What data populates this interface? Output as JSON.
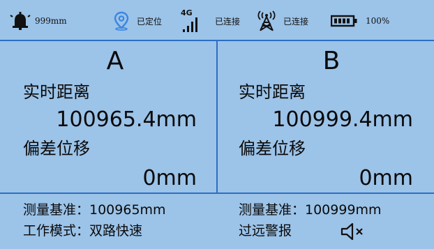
{
  "status": {
    "alarm_value": "999mm",
    "location_text": "已定位",
    "network_type": "4G",
    "network_text": "已连接",
    "signal_text": "已连接",
    "battery_text": "100%"
  },
  "channels": [
    {
      "name": "A",
      "distance_label": "实时距离",
      "distance_value": "100965.4mm",
      "offset_label": "偏差位移",
      "offset_value": "0mm"
    },
    {
      "name": "B",
      "distance_label": "实时距离",
      "distance_value": "100999.4mm",
      "offset_label": "偏差位移",
      "offset_value": "0mm"
    }
  ],
  "footer": {
    "baseline_a": "测量基准：100965mm",
    "baseline_b": "测量基准：100999mm",
    "mode": "工作模式：双路快速",
    "warning": "过远警报"
  },
  "icons": {
    "alarm": "bell-icon",
    "location": "location-pin-icon",
    "network": "cellular-signal-icon",
    "tower": "signal-tower-icon",
    "battery": "battery-icon",
    "mute": "speaker-muted-icon"
  },
  "colors": {
    "background": "#9cc3e8",
    "divider": "#2c6fc4",
    "location_pin": "#3a86e0"
  }
}
